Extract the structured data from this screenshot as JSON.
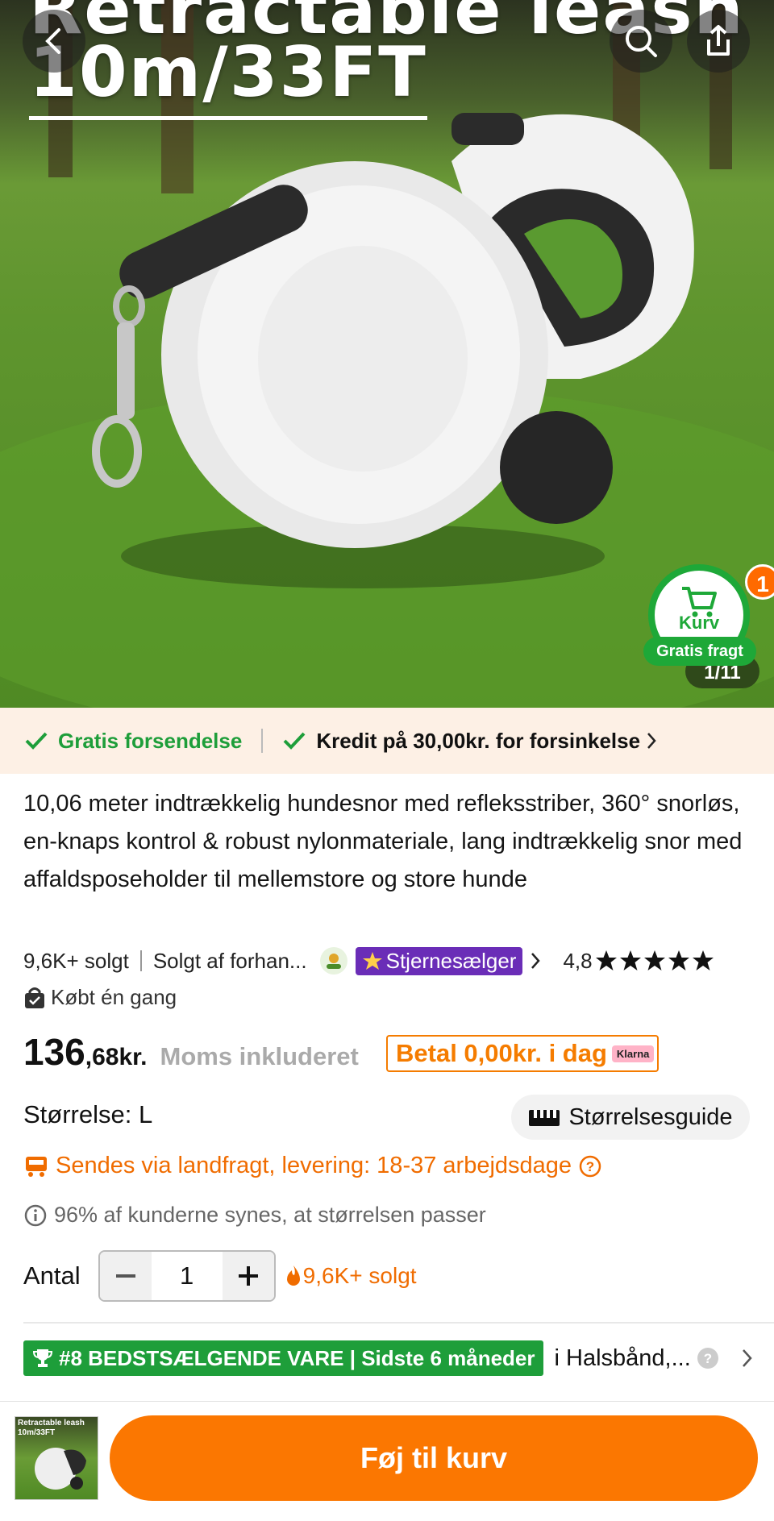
{
  "hero": {
    "image_text_line1": "Retractable leash",
    "image_text_line2": "10m/33FT",
    "image_counter": "1/11"
  },
  "cart_float": {
    "label": "Kurv",
    "badge_count": "1",
    "shipping_pill": "Gratis fragt"
  },
  "shipping_banner": {
    "free_shipping": "Gratis forsendelse",
    "credit": "Kredit på 30,00kr. for forsinkelse"
  },
  "product": {
    "title": "10,06 meter indtrækkelig hundesnor med refleksstriber, 360° snorløs, en-knaps kontrol & robust nylonmateriale, lang indtrækkelig snor med affaldsposeholder til mellemstore og store hunde",
    "sold_count": "9,6K+ solgt",
    "seller": "Solgt af forhan...",
    "star_seller": "Stjernesælger",
    "rating": "4,8",
    "bought_once": "Købt én gang"
  },
  "price": {
    "whole": "136",
    "fraction": ",68kr.",
    "vat_note": "Moms inkluderet",
    "klarna_text": "Betal 0,00kr. i dag",
    "klarna_badge": "Klarna"
  },
  "size": {
    "label": "Størrelse: L",
    "guide_button": "Størrelsesguide"
  },
  "delivery": {
    "text": "Sendes via landfragt, levering: 18-37 arbejdsdage"
  },
  "fit_note": "96% af kunderne synes, at størrelsen passer",
  "quantity": {
    "label": "Antal",
    "value": "1",
    "sold": "9,6K+ solgt"
  },
  "bestseller": {
    "badge": "#8 BEDSTSÆLGENDE VARE | Sidste 6 måneder",
    "category": "i Halsbånd,..."
  },
  "bottom_bar": {
    "thumb_text": "Retractable leash 10m/33FT",
    "add_to_cart": "Føj til kurv"
  },
  "colors": {
    "accent_orange": "#fb7701",
    "green": "#1e9e3a",
    "star_seller_purple": "#6a2db7"
  }
}
